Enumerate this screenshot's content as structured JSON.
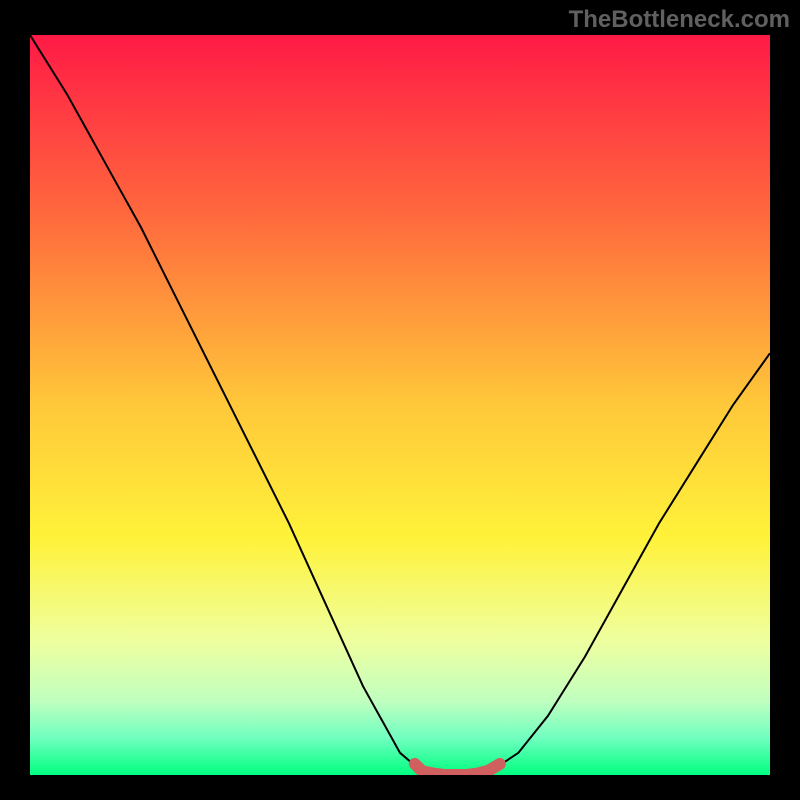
{
  "watermark": "TheBottleneck.com",
  "chart_data": {
    "type": "line",
    "title": "",
    "xlabel": "",
    "ylabel": "",
    "series": [
      {
        "name": "bottleneck-curve",
        "x": [
          0.0,
          0.05,
          0.1,
          0.15,
          0.2,
          0.25,
          0.3,
          0.35,
          0.4,
          0.45,
          0.5,
          0.535,
          0.57,
          0.6,
          0.63,
          0.66,
          0.7,
          0.75,
          0.8,
          0.85,
          0.9,
          0.95,
          1.0
        ],
        "y": [
          1.0,
          0.92,
          0.83,
          0.74,
          0.64,
          0.54,
          0.44,
          0.34,
          0.23,
          0.12,
          0.03,
          0.0,
          0.0,
          0.0,
          0.01,
          0.03,
          0.08,
          0.16,
          0.25,
          0.34,
          0.42,
          0.5,
          0.57
        ]
      }
    ],
    "marker": {
      "name": "optimal-range",
      "x": [
        0.52,
        0.53,
        0.545,
        0.56,
        0.575,
        0.59,
        0.605,
        0.62,
        0.635
      ],
      "y": [
        0.015,
        0.005,
        0.002,
        0.0,
        0.0,
        0.0,
        0.002,
        0.006,
        0.015
      ],
      "color": "#d06060"
    },
    "xlim": [
      0,
      1
    ],
    "ylim": [
      0,
      1
    ],
    "gradient_stops": [
      {
        "offset": 0.0,
        "color": "#ff1a46"
      },
      {
        "offset": 0.25,
        "color": "#ff6b3d"
      },
      {
        "offset": 0.5,
        "color": "#ffc83a"
      },
      {
        "offset": 0.68,
        "color": "#fff23a"
      },
      {
        "offset": 0.82,
        "color": "#eeffa0"
      },
      {
        "offset": 0.9,
        "color": "#c0ffbf"
      },
      {
        "offset": 0.95,
        "color": "#70ffc0"
      },
      {
        "offset": 1.0,
        "color": "#00ff7f"
      }
    ]
  }
}
